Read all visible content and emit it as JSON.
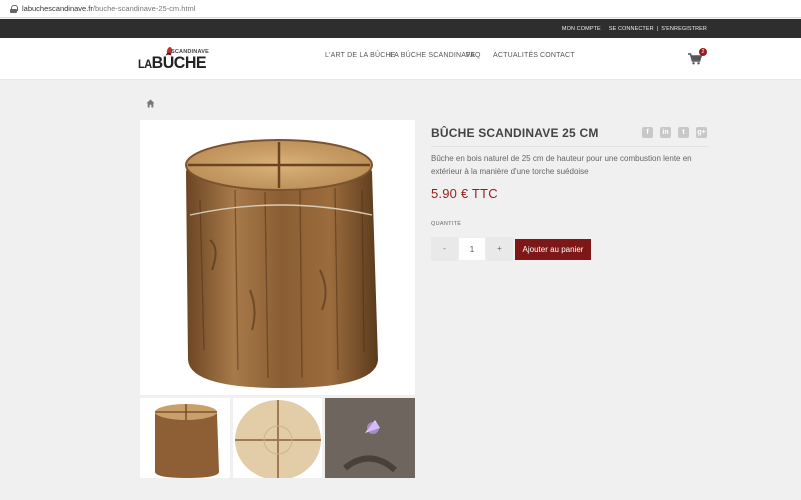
{
  "browser": {
    "domain": "labuchescandinave.fr",
    "path": "/buche-scandinave-25-cm.html"
  },
  "topbar": {
    "account": "MON COMPTE",
    "login": "SE CONNECTER",
    "separator": "|",
    "register": "S'ENREGISTRER"
  },
  "logo": {
    "prefix": "LA",
    "brand": "BÛCHE",
    "tagline": "SCANDINAVE"
  },
  "nav": {
    "items": [
      {
        "label": "L'ART DE LA BÛCHE"
      },
      {
        "label": "LA BÛCHE SCANDINAVE"
      },
      {
        "label": "FAQ"
      },
      {
        "label": "ACTUALITÉS"
      },
      {
        "label": "CONTACT"
      }
    ]
  },
  "cart": {
    "count": "2",
    "icon": "shopping-cart-icon"
  },
  "breadcrumb": {
    "icon": "home-icon"
  },
  "product": {
    "title": "BÛCHE SCANDINAVE 25 CM",
    "description": "Bûche en bois naturel de 25 cm de hauteur pour une combustion lente en extérieur à la manière d'une torche suédoise",
    "price": "5.90 € TTC",
    "quantity_label": "QUANTITÉ",
    "quantity": "1",
    "minus": "-",
    "plus": "+",
    "add_to_cart": "Ajouter au panier"
  },
  "share": [
    {
      "icon": "facebook-icon",
      "glyph": "f"
    },
    {
      "icon": "linkedin-icon",
      "glyph": "in"
    },
    {
      "icon": "twitter-icon",
      "glyph": "t"
    },
    {
      "icon": "google-plus-icon",
      "glyph": "g+"
    }
  ],
  "colors": {
    "accent": "#7e1717",
    "price": "#9b1c1c",
    "topbar": "#2e2e2e"
  }
}
